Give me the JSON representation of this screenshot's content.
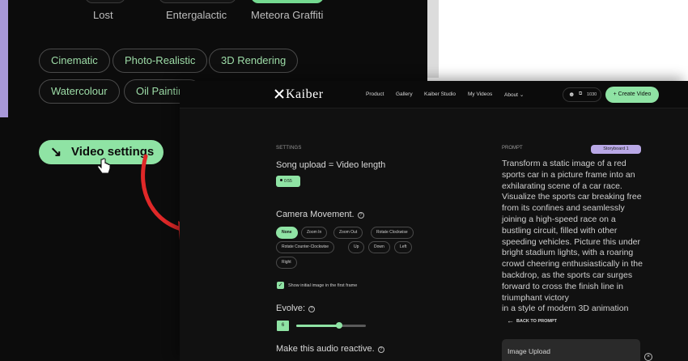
{
  "background": {
    "top_labels": [
      "Lost",
      "Entergalactic",
      "Meteora Graffiti"
    ],
    "style_chips": [
      "Cinematic",
      "Photo-Realistic",
      "3D Rendering",
      "Watercolour",
      "Oil Painting"
    ],
    "video_settings_button": {
      "label": "Video settings",
      "icon": "arrow-down-right-icon"
    },
    "accent_color": "#8fe3a4"
  },
  "app": {
    "logo": "Kaiber",
    "nav": [
      "Product",
      "Gallery",
      "Kaiber Studio",
      "My Videos",
      "About"
    ],
    "about_chevron": "chevron-down-icon",
    "credits": "1030",
    "create_video_label": "+ Create Video"
  },
  "settings": {
    "heading": "SETTINGS",
    "song_upload": "Song upload = Video length",
    "duration": "0:55",
    "camera_title": "Camera Movement.",
    "help_glyph": "?",
    "camera_options": [
      "None",
      "Zoom In",
      "Zoom Out",
      "Rotate Clockwise",
      "Rotate Counter-Clockwise",
      "Up",
      "Down",
      "Left",
      "Right"
    ],
    "camera_selected": "None",
    "show_initial_image": "Show initial image in the first frame",
    "show_initial_checked": true,
    "evolve_title": "Evolve:",
    "evolve_value": "6",
    "evolve_fraction": 0.62,
    "audio_reactive_title": "Make this audio reactive."
  },
  "prompt": {
    "heading": "PROMPT",
    "storyboard_tag": "Storyboard 1",
    "lines": [
      "Transform a static image of a red",
      "sports car in a picture frame into an",
      "exhilarating scene of a car race.",
      "Visualize the sports car breaking free",
      "from its confines and seamlessly",
      "joining a high-speed race on a",
      "bustling circuit, filled with other",
      "speeding vehicles. Picture this under",
      "bright stadium lights, with a roaring",
      "crowd cheering enthusiastically in the",
      "backdrop, as the sports car surges",
      "forward to cross the finish line in",
      "triumphant victory",
      "in a style of modern 3D animation"
    ],
    "back_label": "BACK TO PROMPT",
    "image_upload_label": "Image Upload"
  }
}
